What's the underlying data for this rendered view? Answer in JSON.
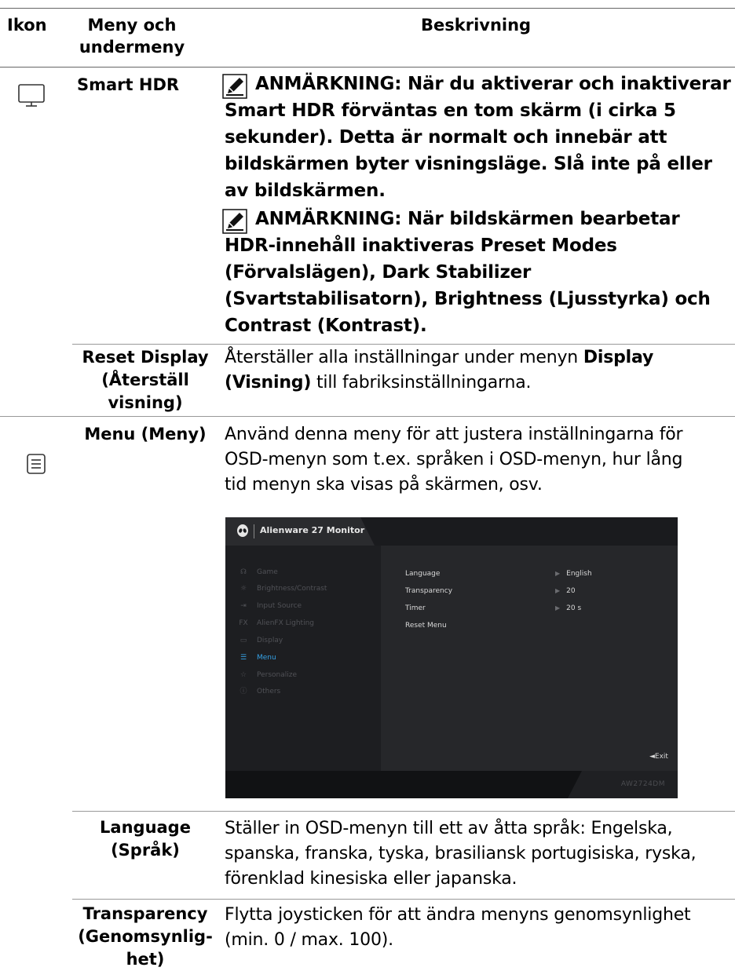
{
  "header": {
    "col_icon": "Ikon",
    "col_menu_line1": "Meny och",
    "col_menu_line2": "undermeny",
    "col_desc": "Beskrivning"
  },
  "rows": {
    "smart_hdr": {
      "label": "Smart HDR",
      "icon": "monitor-icon",
      "note1": [
        "ANMÄRKNING: När du aktiverar och inaktiverar",
        "Smart HDR förväntas en tom skärm (i cirka 5",
        "sekunder). Detta är normalt och innebär att",
        "bildskärmen byter visningsläge. Slå inte på eller",
        "av bildskärmen."
      ],
      "note2": [
        "ANMÄRKNING: När bildskärmen bearbetar",
        "HDR-innehåll inaktiveras Preset Modes",
        "(Förvalslägen), Dark Stabilizer",
        "(Svartstabilisatorn), Brightness (Ljusstyrka) och",
        "Contrast (Kontrast)."
      ]
    },
    "reset_display": {
      "label_lines": [
        "Reset Display",
        "(Återställ",
        "visning)"
      ],
      "desc_line1_a": "Återställer alla inställningar under menyn ",
      "desc_line1_b": "Display",
      "desc_line2_a": "(Visning)",
      "desc_line2_b": " till fabriksinställningarna."
    },
    "menu": {
      "label": "Menu (Meny)",
      "icon": "menu-list-icon",
      "desc": [
        "Använd denna meny för att justera inställningarna för",
        "OSD-menyn som t.ex. språken i OSD-menyn, hur lång",
        "tid menyn ska visas på skärmen, osv."
      ]
    },
    "language": {
      "label_lines": [
        "Language",
        "(Språk)"
      ],
      "desc": [
        "Ställer in OSD-menyn till ett av åtta språk: Engelska,",
        "spanska, franska, tyska, brasiliansk portugisiska, ryska,",
        "förenklad kinesiska eller japanska."
      ]
    },
    "transparency": {
      "label_lines": [
        "Transparency",
        "(Genomsynlig-",
        "het)"
      ],
      "desc": [
        "Flytta joysticken för att ändra menyns genomsynlighet",
        "(min. 0 / max. 100)."
      ]
    }
  },
  "osd": {
    "title": "Alienware 27 Monitor",
    "model": "AW2724DM",
    "exit": "◄Exit",
    "menu_items": [
      {
        "label": "Game",
        "icon": "gamepad-icon",
        "glyph": "☊"
      },
      {
        "label": "Brightness/Contrast",
        "icon": "sun-icon",
        "glyph": "☼"
      },
      {
        "label": "Input Source",
        "icon": "input-icon",
        "glyph": "⇥"
      },
      {
        "label": "AlienFX Lighting",
        "icon": "fx-icon",
        "glyph": "FX"
      },
      {
        "label": "Display",
        "icon": "monitor-icon",
        "glyph": "▭"
      },
      {
        "label": "Menu",
        "icon": "menu-icon",
        "glyph": "☰"
      },
      {
        "label": "Personalize",
        "icon": "star-icon",
        "glyph": "☆"
      },
      {
        "label": "Others",
        "icon": "info-icon",
        "glyph": "ⓘ"
      }
    ],
    "active_index": 5,
    "settings": [
      {
        "label": "Language",
        "value": "English"
      },
      {
        "label": "Transparency",
        "value": "20"
      },
      {
        "label": "Timer",
        "value": "20 s"
      },
      {
        "label": "Reset Menu",
        "value": ""
      }
    ],
    "colors": {
      "accent": "#35a1e5",
      "panel": "#26272a",
      "sidebar": "#1d1e21"
    }
  }
}
